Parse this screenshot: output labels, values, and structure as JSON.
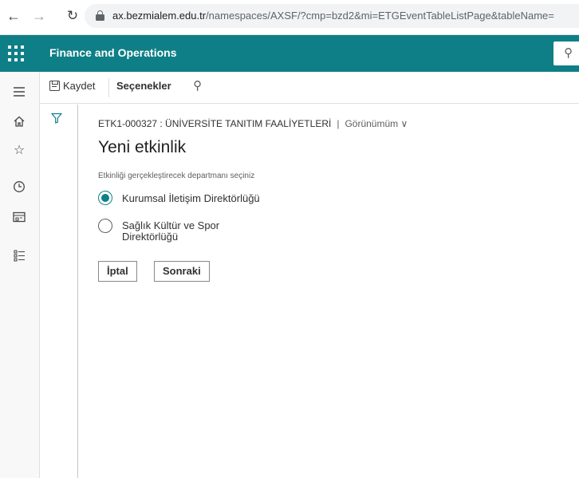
{
  "browser": {
    "url_host": "ax.bezmialem.edu.tr",
    "url_path": "/namespaces/AXSF/?cmp=bzd2&mi=ETGEventTableListPage&tableName="
  },
  "app": {
    "title": "Finance and Operations"
  },
  "actions": {
    "save_label": "Kaydet",
    "options_label": "Seçenekler"
  },
  "form": {
    "record_caption": "ETK1-000327 : ÜNİVERSİTE TANITIM FAALİYETLERİ",
    "view_label": "Görünümüm",
    "view_chevron": "∨",
    "title": "Yeni etkinlik",
    "prompt": "Etkinliği gerçekleştirecek departmanı seçiniz",
    "options": [
      {
        "line1": "Kurumsal İletişim Direktörlüğü",
        "line2": "",
        "selected": true
      },
      {
        "line1": "Sağlık Kültür ve Spor",
        "line2": "Direktörlüğü",
        "selected": false
      }
    ],
    "cancel_label": "İptal",
    "next_label": "Sonraki"
  },
  "colors": {
    "brand": "#0e7f86",
    "rail": "#f8f8f8"
  },
  "icons": [
    "back-icon",
    "forward-icon",
    "reload-icon",
    "lock-icon",
    "waffle-icon",
    "search-icon",
    "hamburger-icon",
    "home-icon",
    "star-icon",
    "clock-icon",
    "workspace-icon",
    "modules-icon",
    "save-icon",
    "filter-icon"
  ]
}
